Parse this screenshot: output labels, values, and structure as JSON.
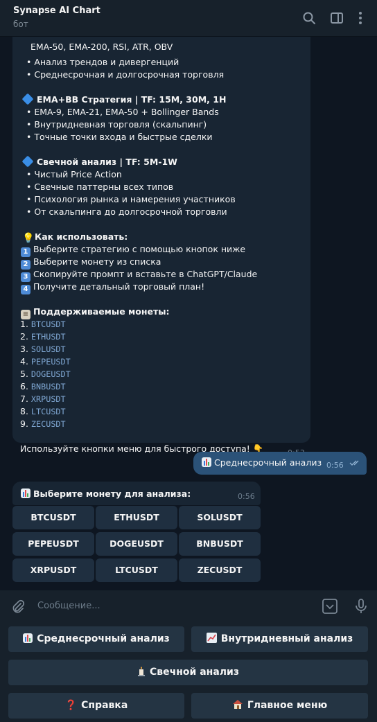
{
  "header": {
    "title": "Synapse AI Chart",
    "subtitle": "бот"
  },
  "message": {
    "lines_top": [
      "EMA-50, EMA-200, RSI, ATR, OBV",
      "• Анализ трендов и дивергенций",
      "• Среднесрочная и долгосрочная торговля"
    ],
    "section_ema_title": "EMA+BB Стратегия | TF: 15M, 30M, 1H",
    "section_ema_lines": [
      "• EMA-9, EMA-21, EMA-50 + Bollinger Bands",
      "• Внутридневная торговля (скальпинг)",
      "• Точные точки входа и быстрые сделки"
    ],
    "section_candle_title": "Свечной анализ | TF: 5M-1W",
    "section_candle_lines": [
      "• Чистый Price Action",
      "• Свечные паттерны всех типов",
      "• Психология рынка и намерения участников",
      "• От скальпинга до долгосрочной торговли"
    ],
    "howto_title": "Как использовать:",
    "howto_steps": [
      "Выберите стратегию с помощью кнопок ниже",
      "Выберите монету из списка",
      "Скопируйте промпт и вставьте в ChatGPT/Claude",
      "Получите детальный торговый план!"
    ],
    "howto_numbers": [
      "1",
      "2",
      "3",
      "4"
    ],
    "coins_title": "Поддерживаемые монеты:",
    "coins": [
      "BTCUSDT",
      "ETHUSDT",
      "SOLUSDT",
      "PEPEUSDT",
      "DOGEUSDT",
      "BNBUSDT",
      "XRPUSDT",
      "LTCUSDT",
      "ZECUSDT"
    ],
    "coin_numbers": [
      "1.",
      "2.",
      "3.",
      "4.",
      "5.",
      "6.",
      "7.",
      "8.",
      "9."
    ],
    "footer": "Используйте кнопки меню для быстрого доступа! 👇",
    "time": "0:53"
  },
  "outgoing": {
    "text": "Среднесрочный анализ",
    "time": "0:56"
  },
  "bot_prompt": {
    "text": "Выберите монету для анализа:",
    "time": "0:56",
    "buttons": [
      "BTCUSDT",
      "ETHUSDT",
      "SOLUSDT",
      "PEPEUSDT",
      "DOGEUSDT",
      "BNBUSDT",
      "XRPUSDT",
      "LTCUSDT",
      "ZECUSDT"
    ]
  },
  "composer": {
    "placeholder": "Сообщение..."
  },
  "keyboard": {
    "mid_term": "Среднесрочный анализ",
    "intraday": "Внутридневный анализ",
    "candle": "Свечной анализ",
    "help": "Справка",
    "main_menu": "Главное меню",
    "icons": [
      "bar-chart-icon",
      "trending-up-icon",
      "candle-icon",
      "question-mark-icon",
      "house-icon"
    ]
  },
  "colors": {
    "background": "#0e1621",
    "panel": "#17212b",
    "bubble_in": "#182533",
    "bubble_out": "#2b5278",
    "link": "#7fa7d3",
    "button": "#243443"
  }
}
